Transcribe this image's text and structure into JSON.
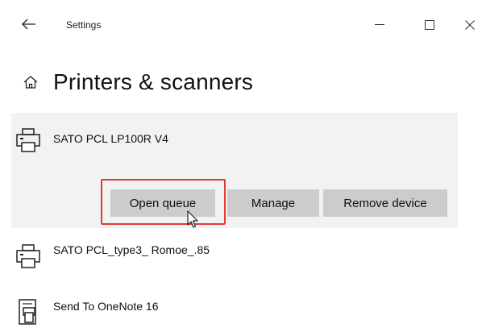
{
  "window": {
    "title": "Settings",
    "back_icon": "back-arrow-icon",
    "minimize_icon": "minimize-icon",
    "maximize_icon": "maximize-icon",
    "close_icon": "close-icon"
  },
  "page": {
    "title": "Printers & scanners",
    "home_icon": "home-icon"
  },
  "printers": [
    {
      "name": "SATO PCL LP100R V4",
      "icon": "printer-icon",
      "selected": true
    },
    {
      "name": "SATO PCL_type3_ Romoe_.85",
      "icon": "printer-icon",
      "selected": false
    },
    {
      "name": "Send To OneNote 16",
      "icon": "onenote-printer-icon",
      "selected": false
    }
  ],
  "actions": {
    "open_queue": "Open queue",
    "manage": "Manage",
    "remove_device": "Remove device"
  },
  "colors": {
    "selected_bg": "#f2f2f2",
    "button_bg": "#cccccc",
    "highlight": "#e53935"
  }
}
